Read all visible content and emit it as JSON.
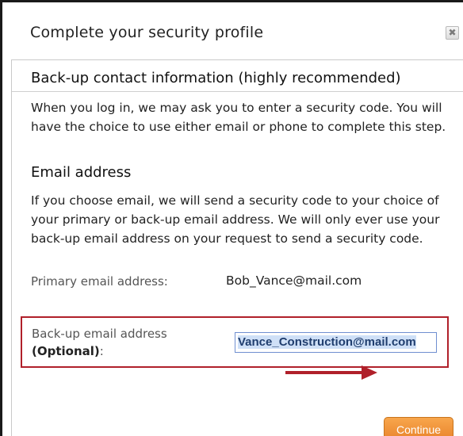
{
  "dialog": {
    "title": "Complete your security profile",
    "close_icon": "close-icon"
  },
  "backup_contact": {
    "heading": "Back-up contact information (highly recommended)",
    "description": "When you log in, we may ask you to enter a security code. You will have the choice to use either email or phone to complete this step."
  },
  "email_section": {
    "heading": "Email address",
    "description": "If you choose email, we will send a security code to your choice of your primary or back-up email address. We will only ever use your back-up email address on your request to send a security code.",
    "primary_label": "Primary email address:",
    "primary_value": "Bob_Vance@mail.com",
    "backup_label_line1": "Back-up email address",
    "backup_label_optional": "(Optional)",
    "backup_label_colon": ":",
    "backup_value": "Vance_Construction@mail.com"
  },
  "actions": {
    "continue_label": "Continue"
  },
  "colors": {
    "highlight_border": "#b0202a",
    "arrow": "#b0202a",
    "button": "#f0902f"
  }
}
